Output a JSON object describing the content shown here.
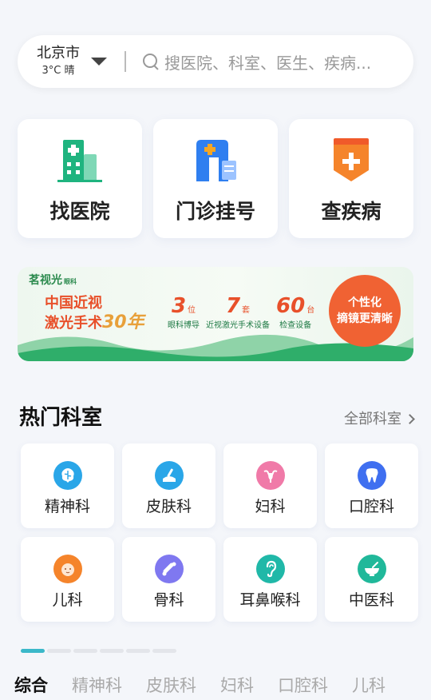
{
  "search": {
    "city": "北京市",
    "weather": "3°C 晴",
    "placeholder": "搜医院、科室、医生、疾病..."
  },
  "quick_actions": [
    {
      "label": "找医院",
      "icon": "hospital-building-icon",
      "color": "#1fb47f"
    },
    {
      "label": "门诊挂号",
      "icon": "clinic-registration-icon",
      "color": "#2f7ff0"
    },
    {
      "label": "查疾病",
      "icon": "medical-kit-icon",
      "color": "#f5842b"
    }
  ],
  "banner": {
    "brand": "茗视光",
    "brand_sub": "眼科",
    "headline_1": "中国近视",
    "headline_2": "激光手术",
    "headline_years": "30年",
    "stats": [
      {
        "num": "3",
        "unit": "位",
        "label": "眼科博导"
      },
      {
        "num": "7",
        "unit": "套",
        "label": "近视激光手术设备"
      },
      {
        "num": "60",
        "unit": "台",
        "label": "检查设备"
      }
    ],
    "bubble_1": "个性化",
    "bubble_2": "摘镜更清晰"
  },
  "departments": {
    "title": "热门科室",
    "more_label": "全部科室",
    "items": [
      {
        "label": "精神科",
        "icon": "brain-icon",
        "color": "#2aa6e8"
      },
      {
        "label": "皮肤科",
        "icon": "skin-icon",
        "color": "#2aa6e8"
      },
      {
        "label": "妇科",
        "icon": "uterus-icon",
        "color": "#f07aa8"
      },
      {
        "label": "口腔科",
        "icon": "tooth-icon",
        "color": "#3f6ff0"
      },
      {
        "label": "儿科",
        "icon": "baby-face-icon",
        "color": "#f5842b"
      },
      {
        "label": "骨科",
        "icon": "bone-icon",
        "color": "#7f78f0"
      },
      {
        "label": "耳鼻喉科",
        "icon": "ear-icon",
        "color": "#20b8a8"
      },
      {
        "label": "中医科",
        "icon": "herbal-mortar-icon",
        "color": "#20b89a"
      }
    ]
  },
  "pager": {
    "pages": 6,
    "active": 1
  },
  "tabs": [
    "综合",
    "精神科",
    "皮肤科",
    "妇科",
    "口腔科",
    "儿科"
  ],
  "active_tab": "综合"
}
